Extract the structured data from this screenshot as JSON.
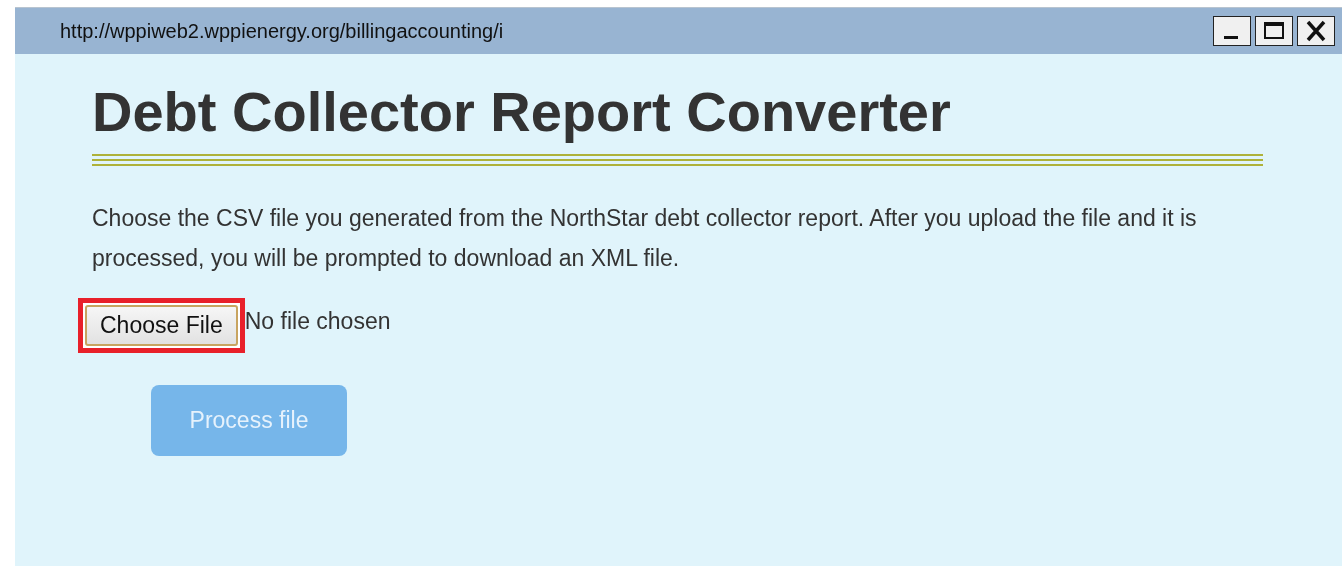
{
  "window": {
    "title": "http://wppiweb2.wppienergy.org/billingaccounting/i"
  },
  "heading": "Debt Collector Report Converter",
  "instructions": "Choose the CSV file you generated from the NorthStar debt collector report. After you upload the file and it is processed, you will be prompted to download an XML file.",
  "file_picker": {
    "button": "Choose File",
    "status": "No file chosen",
    "highlighted": true
  },
  "process_button": {
    "label": "Process file",
    "disabled": true
  }
}
